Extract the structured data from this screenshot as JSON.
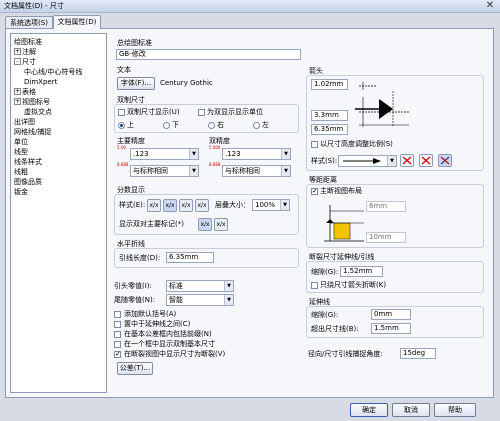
{
  "window": {
    "title": "文档属性(D) - 尺寸",
    "close_glyph": "✕"
  },
  "tabs": [
    {
      "label": "系统选项(S)"
    },
    {
      "label": "文档属性(D)"
    }
  ],
  "tree": {
    "items": [
      {
        "label": "绘图标准",
        "toggle": ""
      },
      {
        "label": "注解",
        "toggle": "+"
      },
      {
        "label": "尺寸",
        "toggle": "-"
      },
      {
        "label": "中心线/中心符号线",
        "toggle": ""
      },
      {
        "label": "DimXpert",
        "toggle": ""
      },
      {
        "label": "表格",
        "toggle": "+"
      },
      {
        "label": "视图标号",
        "toggle": "+"
      },
      {
        "label": "虚拟交点",
        "toggle": ""
      },
      {
        "label": "出详图",
        "toggle": ""
      },
      {
        "label": "网格线/捕捉",
        "toggle": ""
      },
      {
        "label": "单位",
        "toggle": ""
      },
      {
        "label": "线型",
        "toggle": ""
      },
      {
        "label": "线条样式",
        "toggle": ""
      },
      {
        "label": "线粗",
        "toggle": ""
      },
      {
        "label": "图像品质",
        "toggle": ""
      },
      {
        "label": "钣金",
        "toggle": ""
      }
    ]
  },
  "overall_standard": {
    "title": "总绘图标准",
    "value": "GB-修改"
  },
  "text": {
    "title": "文本",
    "font_button": "字体(F)...",
    "font_name": "Century Gothic"
  },
  "dual_dims": {
    "title": "双制尺寸",
    "show_dual": "双制尺寸显示(U)",
    "show_units": "为双显示显示单位",
    "pos_top": "上",
    "pos_bottom": "下",
    "pos_right": "右",
    "pos_left": "左"
  },
  "primary_precision": {
    "title": "主要精度",
    "value1": ".123",
    "value2": "与标称相同",
    "sample1": "5.00",
    "sample2": "8.888"
  },
  "dual_precision": {
    "title": "双精度",
    "value1": ".123",
    "value2": "与标称相同",
    "sample1": "5.000",
    "sample2": "8.888"
  },
  "fraction": {
    "title": "分数显示",
    "style_label": "样式(E):",
    "stack_size_label": "层叠大小：",
    "stack_size_value": "100%",
    "show_dual_label": "显示双对主要标记(*)",
    "styles": [
      "x/x",
      "x/x",
      "x/x",
      "x/x"
    ]
  },
  "horizontal_leader": {
    "title": "水平折线",
    "length_label": "引线长度(D):",
    "length_value": "6.35mm"
  },
  "arrows": {
    "title": "箭头",
    "v1": "1.02mm",
    "v2": "3.3mm",
    "v3": "6.35mm",
    "scale_label": "以尺寸高度调整比例(S)",
    "style_label": "样式(S):"
  },
  "offset": {
    "title": "等距距离",
    "snap_label": "主断视图布局",
    "v1": "6mm",
    "v2": "10mm"
  },
  "break_line": {
    "title": "断裂尺寸延伸线/引线",
    "gap_label": "缩隙(G):",
    "gap_value": "1.52mm",
    "arrow_break_label": "只绕尺寸箭头折断(K)"
  },
  "extension": {
    "title": "延伸线",
    "gap_label": "缩隙(G):",
    "gap_value": "0mm",
    "beyond_label": "超出尺寸线(B):",
    "beyond_value": "1.5mm"
  },
  "snap_angle": {
    "label": "径向/尺寸引线捕捉角度:",
    "value": "15deg"
  },
  "leader_zeros": {
    "label": "引头零值(I):",
    "value": "标准"
  },
  "trailing_zeros": {
    "label": "尾随零值(N):",
    "value": "智能"
  },
  "options": {
    "o1": "添加默认括号(A)",
    "o2": "置中于延伸线之间(C)",
    "o3": "在基本公差框内包括前缀(N)",
    "o4": "在一个框中显示双制基本尺寸",
    "o5": "在断裂视图中显示尺寸为断裂(V)"
  },
  "tolerance_button": "公差(T)...",
  "buttons": {
    "ok": "确定",
    "cancel": "取消",
    "help": "帮助"
  },
  "colors": {
    "accent": "#3a78d8",
    "preview_red": "#cc0000",
    "preview_yellow": "#f3c400"
  }
}
